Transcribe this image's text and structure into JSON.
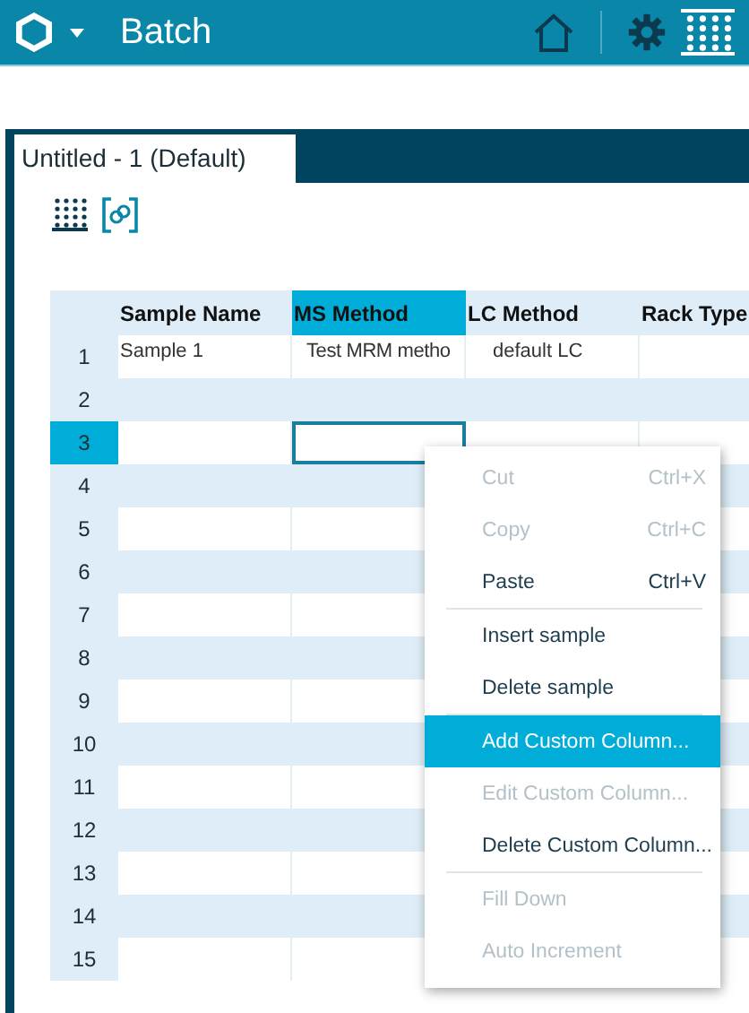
{
  "app_bar": {
    "title": "Batch"
  },
  "document_tabs": [
    {
      "label": "Untitled - 1 (Default)",
      "selected": true
    }
  ],
  "table": {
    "columns": [
      {
        "label": "Sample Name",
        "selected": false
      },
      {
        "label": "MS Method",
        "selected": true
      },
      {
        "label": "LC Method",
        "selected": false
      },
      {
        "label": "Rack Type",
        "selected": false
      }
    ],
    "rows": [
      {
        "label": "1",
        "selected": false,
        "cells": [
          "Sample 1",
          "Test MRM metho",
          "default LC"
        ]
      },
      {
        "label": "2",
        "selected": false
      },
      {
        "label": "3",
        "selected": true
      },
      {
        "label": "4",
        "selected": false
      },
      {
        "label": "5",
        "selected": false
      },
      {
        "label": "6",
        "selected": false
      },
      {
        "label": "7",
        "selected": false
      },
      {
        "label": "8",
        "selected": false
      },
      {
        "label": "9",
        "selected": false
      },
      {
        "label": "10",
        "selected": false
      },
      {
        "label": "11",
        "selected": false
      },
      {
        "label": "12",
        "selected": false
      },
      {
        "label": "13",
        "selected": false
      },
      {
        "label": "14",
        "selected": false
      },
      {
        "label": "15",
        "selected": false
      }
    ]
  },
  "context_menu": {
    "items": [
      {
        "kind": "item",
        "label": "Cut",
        "shortcut": "Ctrl+X",
        "disabled": true,
        "selected": false
      },
      {
        "kind": "item",
        "label": "Copy",
        "shortcut": "Ctrl+C",
        "disabled": true,
        "selected": false
      },
      {
        "kind": "item",
        "label": "Paste",
        "shortcut": "Ctrl+V",
        "disabled": false,
        "selected": false
      },
      {
        "kind": "separator"
      },
      {
        "kind": "item",
        "label": "Insert sample",
        "disabled": false,
        "selected": false
      },
      {
        "kind": "item",
        "label": "Delete sample",
        "disabled": false,
        "selected": false
      },
      {
        "kind": "separator"
      },
      {
        "kind": "item",
        "label": "Add Custom Column...",
        "disabled": false,
        "selected": true
      },
      {
        "kind": "item",
        "label": "Edit Custom Column...",
        "disabled": true,
        "selected": false
      },
      {
        "kind": "item",
        "label": "Delete Custom Column...",
        "disabled": false,
        "selected": false
      },
      {
        "kind": "separator"
      },
      {
        "kind": "item",
        "label": "Fill Down",
        "disabled": true,
        "selected": false
      },
      {
        "kind": "item",
        "label": "Auto Increment",
        "disabled": true,
        "selected": false
      }
    ]
  }
}
